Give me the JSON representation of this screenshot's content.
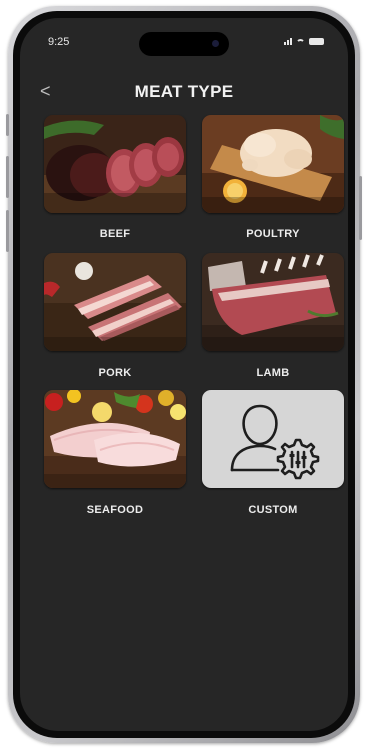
{
  "status_bar": {
    "time": "9:25",
    "icons": [
      "signal-icon",
      "wifi-icon",
      "battery-icon"
    ]
  },
  "header": {
    "back_icon": "chevron-left-icon",
    "back_glyph": "<",
    "title": "MEAT TYPE"
  },
  "meat_types": [
    {
      "label": "BEEF"
    },
    {
      "label": "POULTRY"
    },
    {
      "label": "PORK"
    },
    {
      "label": "LAMB"
    },
    {
      "label": "SEAFOOD"
    },
    {
      "label": "CUSTOM",
      "icon": "custom-user-gear-icon"
    }
  ],
  "colors": {
    "screen_bg": "#262626",
    "title": "#f2f2f2",
    "label": "#ececec",
    "custom_tile_bg": "#d6d6d6"
  }
}
